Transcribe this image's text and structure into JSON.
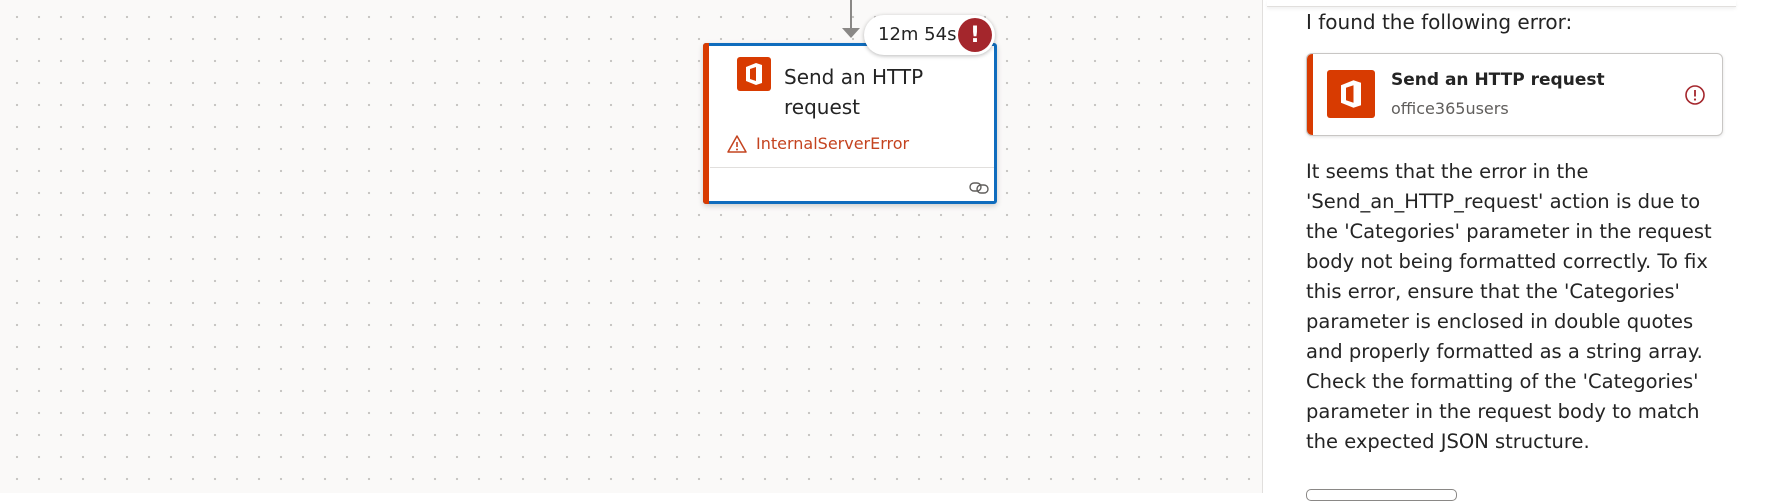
{
  "canvas": {
    "action_card": {
      "title": "Send an HTTP request",
      "error_text": "InternalServerError",
      "icon": "office365-icon"
    },
    "duration": {
      "label": "12m 54s",
      "status_glyph": "!"
    }
  },
  "panel": {
    "intro": "I found the following error:",
    "error_card": {
      "title": "Send an HTTP request",
      "subtitle": "office365users",
      "icon": "office365-icon",
      "alert_icon": "alert-circle-icon"
    },
    "message": "It seems that the error in the 'Send_an_HTTP_request' action is due to the 'Categories' parameter in the request body not being formatted correctly. To fix this error, ensure that the 'Categories' parameter is enclosed in double quotes and properly formatted as a string array. Check the formatting of the 'Categories' parameter in the request body to match the expected JSON structure."
  },
  "colors": {
    "accent_blue": "#0f6cbd",
    "office_orange": "#d83b01",
    "error_red": "#a4262c",
    "error_text": "#c4431f"
  }
}
